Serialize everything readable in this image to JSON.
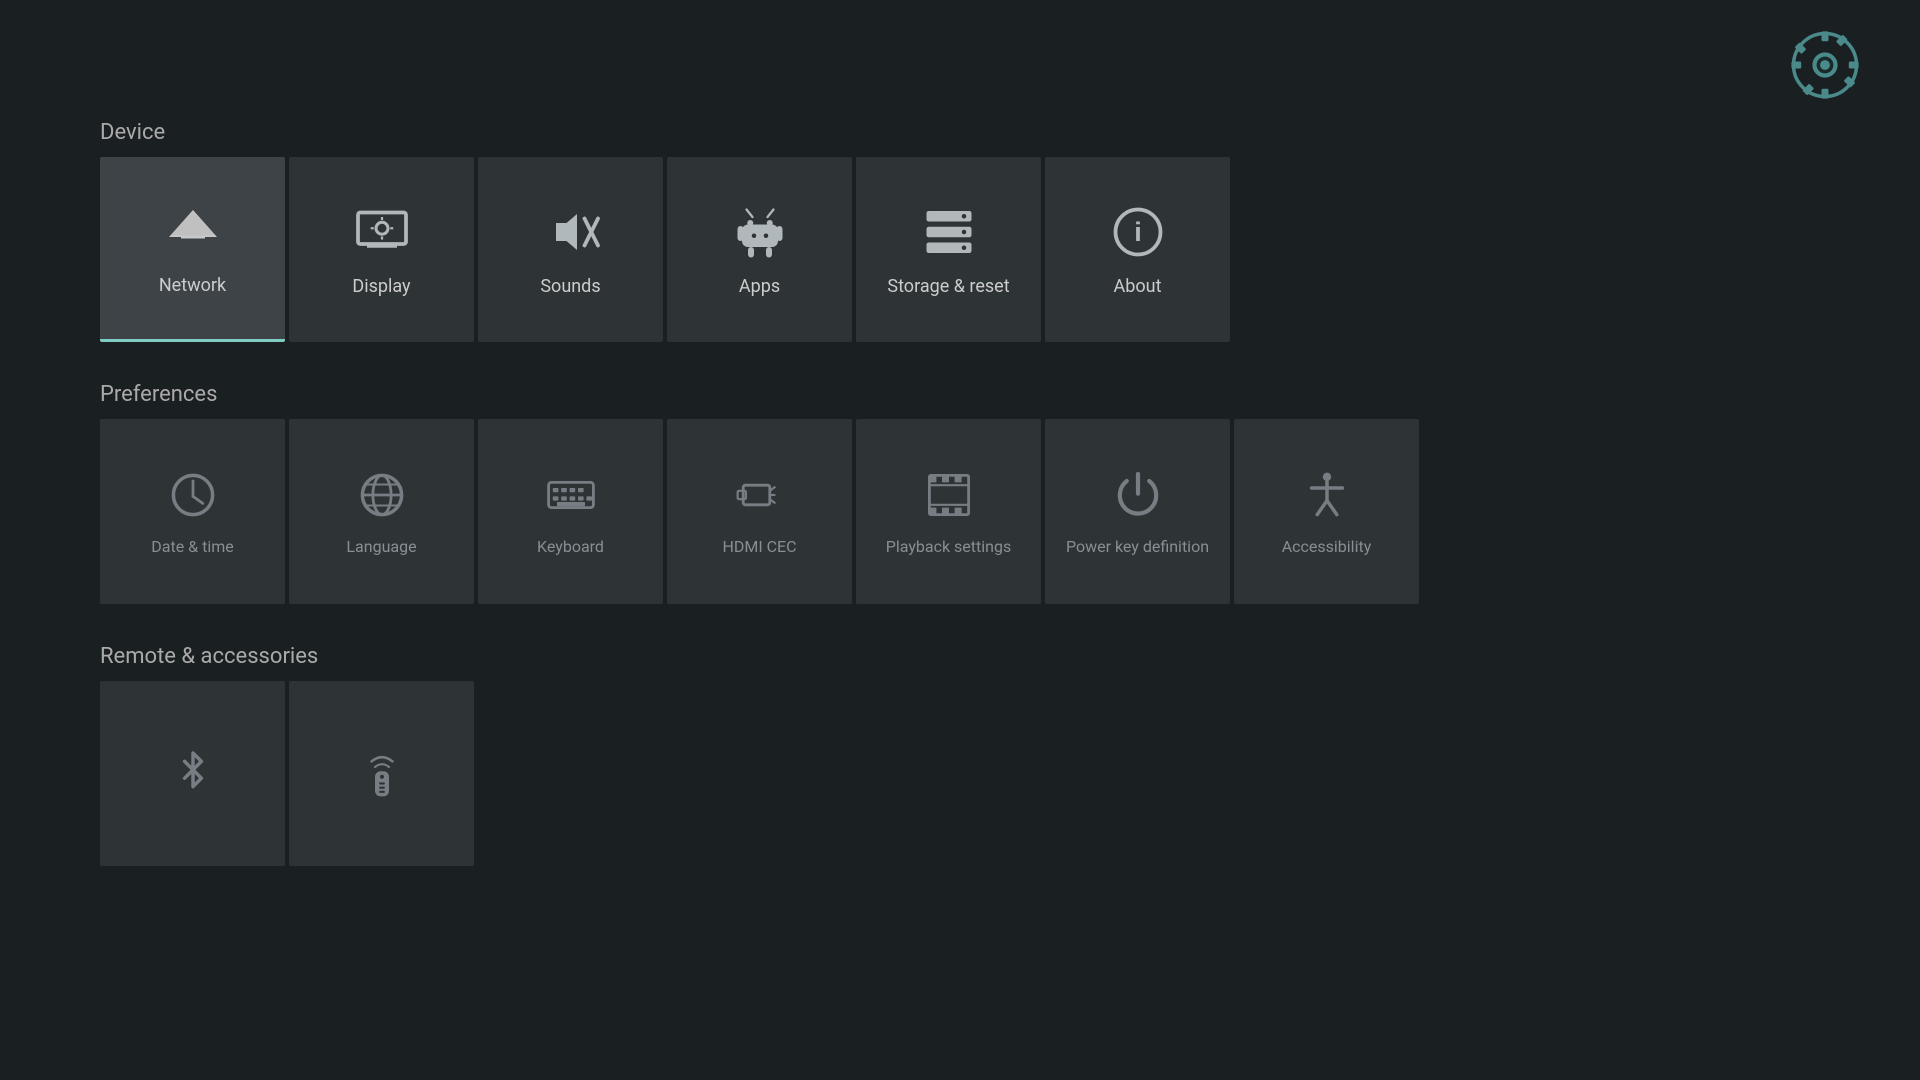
{
  "topIcon": {
    "label": "Settings gear icon"
  },
  "sections": [
    {
      "id": "device",
      "title": "Device",
      "tiles": [
        {
          "id": "network",
          "label": "Network",
          "icon": "network"
        },
        {
          "id": "display",
          "label": "Display",
          "icon": "display"
        },
        {
          "id": "sounds",
          "label": "Sounds",
          "icon": "sounds"
        },
        {
          "id": "apps",
          "label": "Apps",
          "icon": "apps"
        },
        {
          "id": "storage",
          "label": "Storage & reset",
          "icon": "storage"
        },
        {
          "id": "about",
          "label": "About",
          "icon": "about"
        }
      ]
    },
    {
      "id": "preferences",
      "title": "Preferences",
      "tiles": [
        {
          "id": "date",
          "label": "Date & time",
          "icon": "date"
        },
        {
          "id": "language",
          "label": "Language",
          "icon": "language"
        },
        {
          "id": "keyboard",
          "label": "Keyboard",
          "icon": "keyboard"
        },
        {
          "id": "hdmi",
          "label": "HDMI CEC",
          "icon": "hdmi"
        },
        {
          "id": "playback",
          "label": "Playback settings",
          "icon": "playback"
        },
        {
          "id": "powerkey",
          "label": "Power key definition",
          "icon": "power"
        },
        {
          "id": "accessibility",
          "label": "Accessibility",
          "icon": "accessibility"
        }
      ]
    },
    {
      "id": "remote",
      "title": "Remote & accessories",
      "tiles": [
        {
          "id": "bluetooth",
          "label": "",
          "icon": "bluetooth"
        },
        {
          "id": "remote",
          "label": "",
          "icon": "remote"
        }
      ]
    }
  ]
}
